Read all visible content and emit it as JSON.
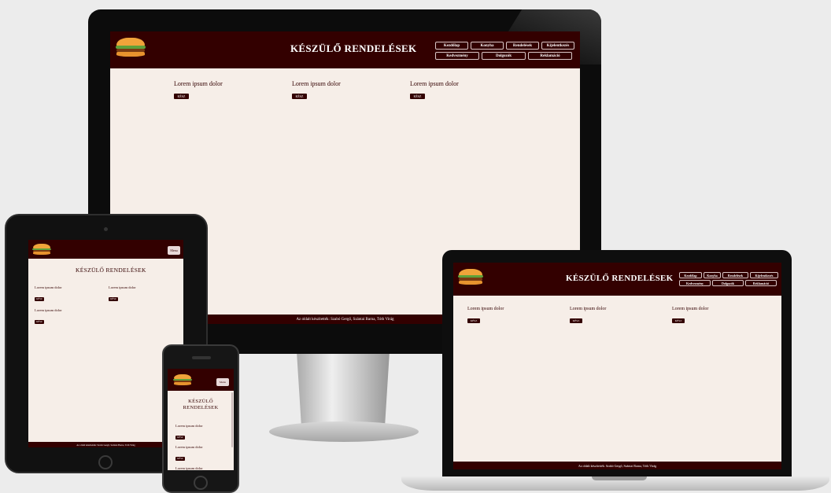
{
  "page": {
    "title": "KÉSZÜLŐ RENDELÉSEK",
    "title_line1": "KÉSZÜLŐ",
    "title_line2": "RENDELÉSEK",
    "menu_button": "Menu",
    "footer": "Az oldalt készítették: Szabó Gergő, Szántai Barna, Tóth Virág",
    "nav": {
      "row1": [
        "Kezdőlap",
        "Konyha",
        "Rendelések",
        "Kijelentkezés"
      ],
      "row2": [
        "Kedvezmény",
        "Dolgozók",
        "Reklamáció"
      ]
    },
    "orders": [
      {
        "title": "Lorem ipsum dolor",
        "button": "KÉSZ"
      },
      {
        "title": "Lorem ipsum dolor",
        "button": "KÉSZ"
      },
      {
        "title": "Lorem ipsum dolor",
        "button": "KÉSZ"
      }
    ]
  },
  "colors": {
    "header": "#330000",
    "background": "#f6eee8",
    "bun": "#f0a43a",
    "lettuce": "#5fa13a"
  },
  "icons": {
    "logo": "burger-icon"
  }
}
